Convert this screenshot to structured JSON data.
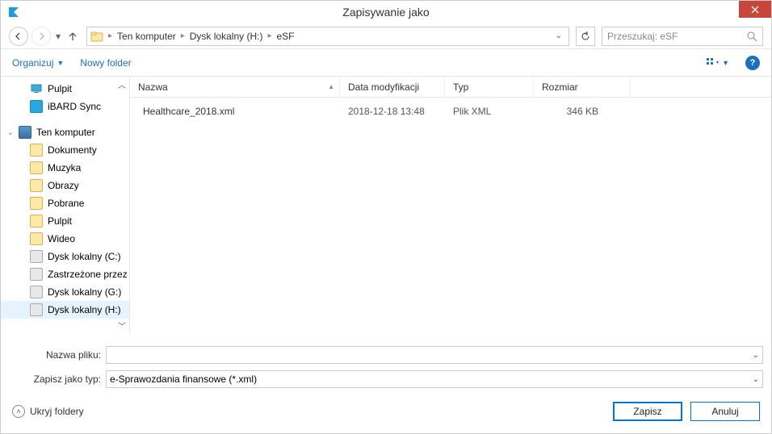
{
  "title": "Zapisywanie jako",
  "breadcrumb": {
    "root": "Ten komputer",
    "drive": "Dysk lokalny (H:)",
    "folder": "eSF"
  },
  "search": {
    "placeholder": "Przeszukaj: eSF"
  },
  "toolbar": {
    "organize": "Organizuj",
    "new_folder": "Nowy folder"
  },
  "tree": {
    "quick": [
      {
        "label": "Pulpit",
        "icon": "desktop"
      },
      {
        "label": "iBARD Sync",
        "icon": "sync"
      }
    ],
    "this_pc": "Ten komputer",
    "children": [
      {
        "label": "Dokumenty",
        "icon": "folder"
      },
      {
        "label": "Muzyka",
        "icon": "folder"
      },
      {
        "label": "Obrazy",
        "icon": "folder"
      },
      {
        "label": "Pobrane",
        "icon": "folder"
      },
      {
        "label": "Pulpit",
        "icon": "folder"
      },
      {
        "label": "Wideo",
        "icon": "folder"
      },
      {
        "label": "Dysk lokalny (C:)",
        "icon": "drive"
      },
      {
        "label": "Zastrzeżone przez system",
        "icon": "drive"
      },
      {
        "label": "Dysk lokalny (G:)",
        "icon": "drive"
      },
      {
        "label": "Dysk lokalny (H:)",
        "icon": "drive",
        "selected": true
      }
    ]
  },
  "columns": {
    "name": "Nazwa",
    "date": "Data modyfikacji",
    "type": "Typ",
    "size": "Rozmiar"
  },
  "files": [
    {
      "name": "Healthcare_2018.xml",
      "date": "2018-12-18 13:48",
      "type": "Plik XML",
      "size": "346 KB"
    }
  ],
  "fields": {
    "filename_label": "Nazwa pliku:",
    "filename_value": "",
    "filetype_label": "Zapisz jako typ:",
    "filetype_value": "e-Sprawozdania finansowe (*.xml)"
  },
  "footer": {
    "hide": "Ukryj foldery",
    "save": "Zapisz",
    "cancel": "Anuluj"
  }
}
